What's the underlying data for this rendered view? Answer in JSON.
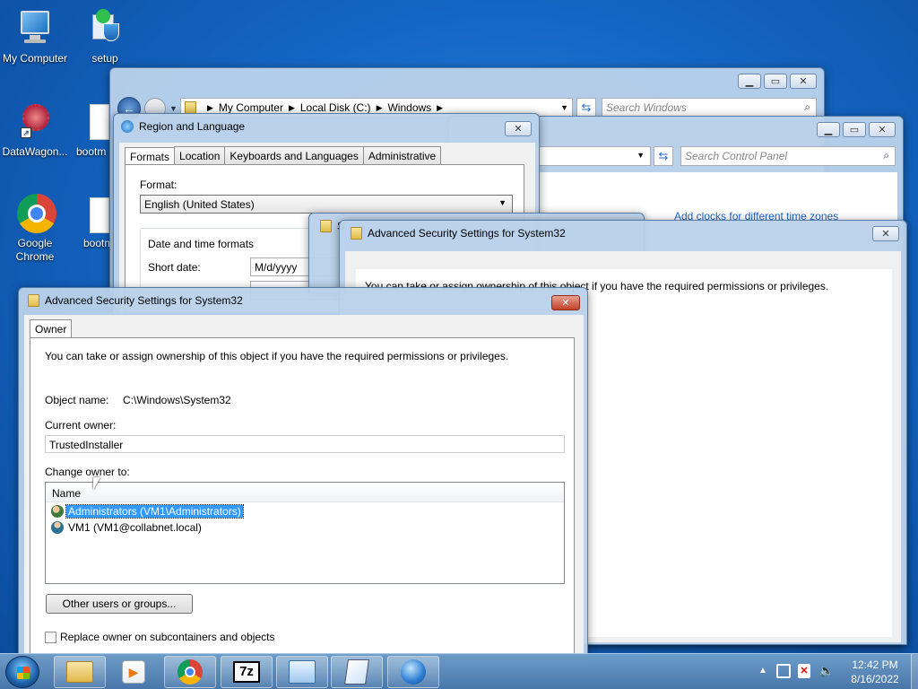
{
  "desktop": {
    "icons": [
      {
        "label": "My Computer"
      },
      {
        "label": "setup"
      },
      {
        "label": "DataWagon..."
      },
      {
        "label": "bootm"
      },
      {
        "label": "Google Chrome"
      },
      {
        "label": "bootm"
      }
    ]
  },
  "explorer": {
    "breadcrumb": [
      "My Computer",
      "Local Disk (C:)",
      "Windows"
    ],
    "search_placeholder": "Search Windows"
  },
  "control_panel": {
    "search_placeholder": "Search Control Panel",
    "link": "Add clocks for different time zones"
  },
  "region": {
    "title": "Region and Language",
    "tabs": [
      "Formats",
      "Location",
      "Keyboards and Languages",
      "Administrative"
    ],
    "format_label": "Format:",
    "format_value": "English (United States)",
    "section_label": "Date and time formats",
    "short_date_label": "Short date:",
    "short_date_value": "M/d/yyyy"
  },
  "adv_back": {
    "title": "Advanced Security Settings for System32",
    "message": "You can take or assign ownership of this object if you have the required permissions or privileges.",
    "peek": "S"
  },
  "adv_front": {
    "title": "Advanced Security Settings for System32",
    "tab": "Owner",
    "message": "You can take or assign ownership of this object if you have the required permissions or privileges.",
    "object_name_label": "Object name:",
    "object_name_value": "C:\\Windows\\System32",
    "current_owner_label": "Current owner:",
    "current_owner_value": "TrustedInstaller",
    "change_owner_label": "Change owner to:",
    "column_name": "Name",
    "owners": [
      "Administrators (VM1\\Administrators)",
      "VM1 (VM1@collabnet.local)"
    ],
    "other_users_button": "Other users or groups...",
    "replace_owner_label": "Replace owner on subcontainers and objects"
  },
  "taskbar": {
    "time": "12:42 PM",
    "date": "8/16/2022",
    "apps": [
      "folder-icon",
      "media-player-icon",
      "chrome-icon",
      "7zip-icon",
      "control-panel-icon",
      "notepad-icon",
      "network-globe-icon"
    ]
  }
}
